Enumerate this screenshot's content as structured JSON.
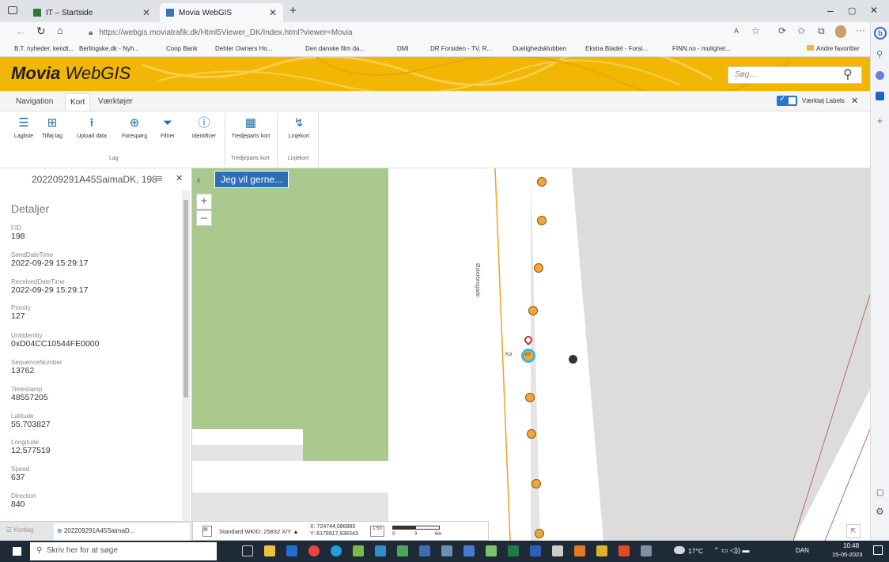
{
  "browser": {
    "tabs": [
      {
        "title": "IT – Startside"
      },
      {
        "title": "Movia WebGIS"
      }
    ],
    "url": "https://webgis.moviatrafik.dk/Html5Viewer_DK/Index.html?viewer=Movia",
    "favorites": [
      "B.T. nyheder, kendt...",
      "Berlingske.dk - Nyh...",
      "Coop Bank",
      "Dehler Owners Ho...",
      "Den danske film da...",
      "DMI",
      "DR Forsiden - TV, R...",
      "Duelighedsklubben",
      "Ekstra Bladet - Forsi...",
      "FINN.no - mulighet..."
    ],
    "other_favorites": "Andre favoritter"
  },
  "app": {
    "brand_bold": "Movia",
    "brand_rest": " WebGIS",
    "search_placeholder": "Søg..."
  },
  "ribbon": {
    "tabs": [
      "Navigation",
      "Kort",
      "Værktøjer"
    ],
    "active_tab": "Kort",
    "tool_labels_toggle": "Værktøj Labels",
    "buttons": [
      {
        "label": "Lagliste",
        "icon": "layers-icon"
      },
      {
        "label": "Tilføj lag",
        "icon": "add-layer-icon"
      },
      {
        "label": "Upload data",
        "icon": "upload-icon"
      },
      {
        "label": "Forespørg",
        "icon": "query-icon"
      },
      {
        "label": "Filtrer",
        "icon": "filter-icon"
      },
      {
        "label": "Identificer",
        "icon": "identify-icon"
      },
      {
        "label": "Tredjeparts kort",
        "icon": "third-party-map-icon"
      },
      {
        "label": "Linjekort",
        "icon": "line-map-icon"
      }
    ],
    "groups": [
      "Lag",
      "Tredjeparts kort",
      "Linjekort"
    ]
  },
  "panel": {
    "title": "202209291A45SaimaDK, 198",
    "section": "Detaljer",
    "fields": [
      {
        "label": "FID",
        "value": "198"
      },
      {
        "label": "SendDateTime",
        "value": "2022-09-29 15:29:17"
      },
      {
        "label": "ReceivedDateTime",
        "value": "2022-09-29 15:29:17"
      },
      {
        "label": "Priority",
        "value": "127"
      },
      {
        "label": "Unitidentity",
        "value": "0xD04CC10544FE0000"
      },
      {
        "label": "SequenceNumber",
        "value": "13762"
      },
      {
        "label": "Timestamp",
        "value": "48557205"
      },
      {
        "label": "Latitude",
        "value": "55,703827"
      },
      {
        "label": "Longitude",
        "value": "12,577519"
      },
      {
        "label": "Speed",
        "value": "637"
      },
      {
        "label": "Direction",
        "value": "840"
      }
    ],
    "bottom_tabs": [
      "Kortlag",
      "202209291A45SaimaD..."
    ]
  },
  "map": {
    "jeg_vil_gerne": "Jeg vil gerne...",
    "street_label": "Østerbrogade",
    "stop_label": "Ka        vn",
    "projection": "Standard WKID: 25832 X/Y ▲",
    "x_coord": "X: 724744,086880",
    "y_coord": "Y: 6178917,938343",
    "scale_labels": [
      "0",
      "3",
      "6m"
    ]
  },
  "taskbar": {
    "search": "Skriv her for at søge",
    "weather": "17°C",
    "lang": "DAN",
    "time": "10:48",
    "date": "15-05-2023"
  }
}
